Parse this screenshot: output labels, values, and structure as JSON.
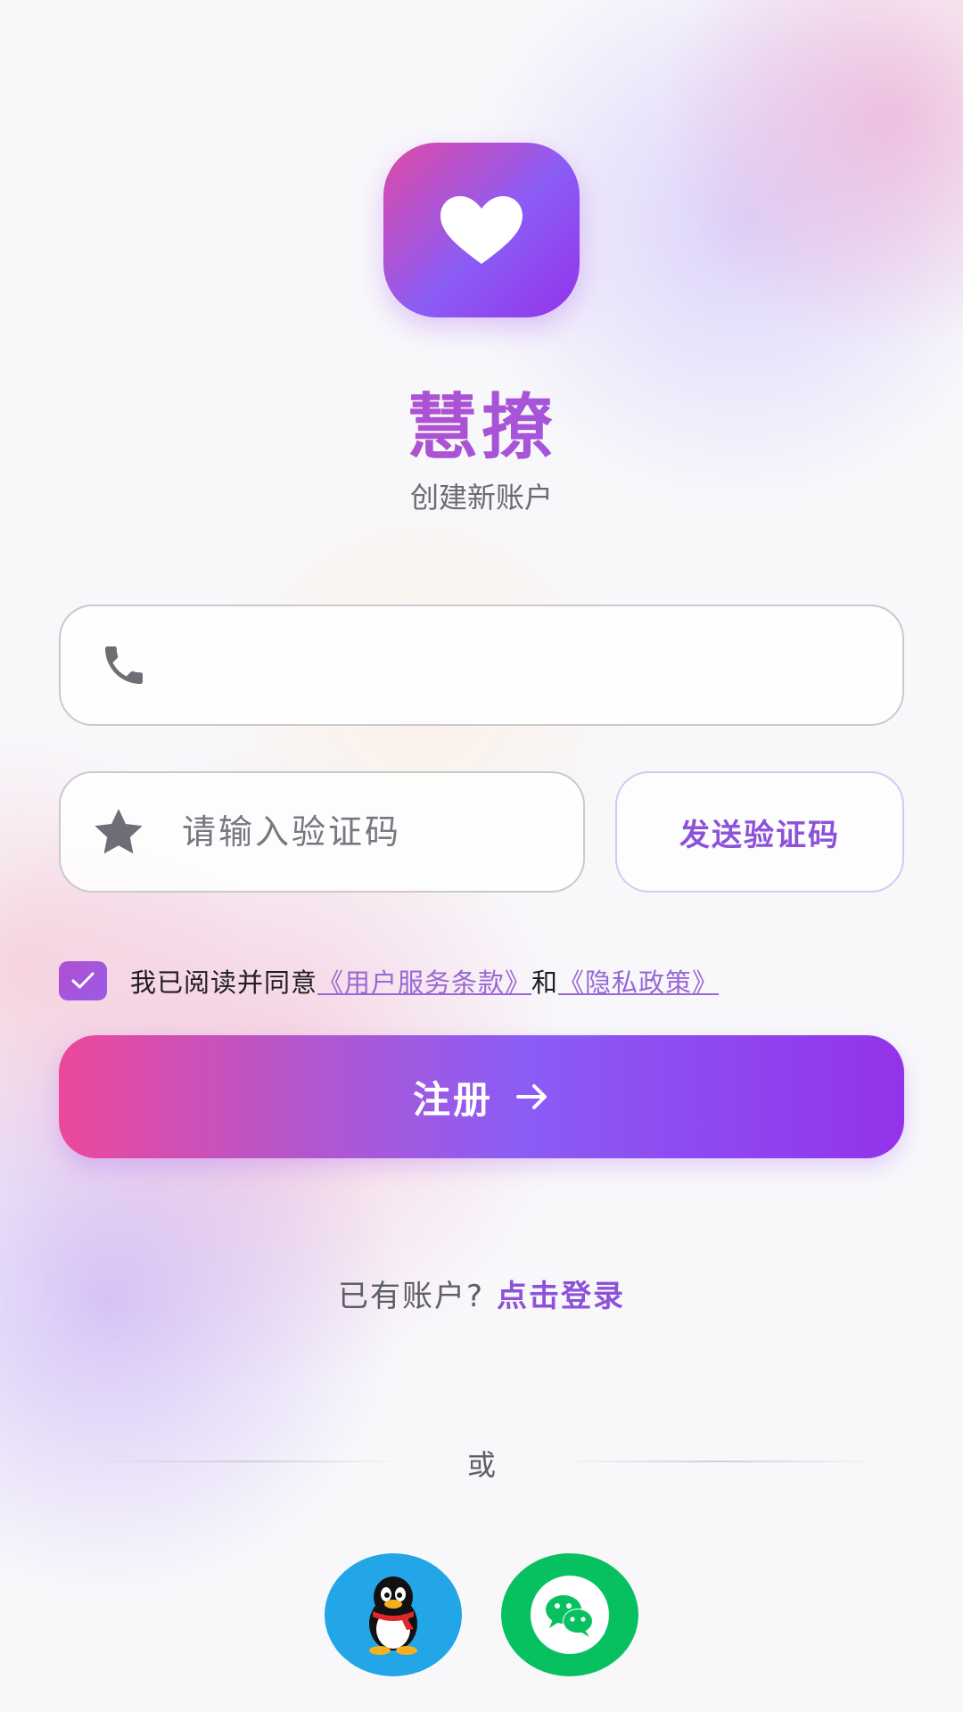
{
  "app": {
    "name": "慧撩",
    "subtitle": "创建新账户"
  },
  "form": {
    "phone": {
      "value": "",
      "placeholder": ""
    },
    "code": {
      "value": "",
      "placeholder": "请输入验证码"
    },
    "send_code_label": "发送验证码"
  },
  "agreement": {
    "checked": true,
    "prefix": "我已阅读并同意",
    "terms_link": "《用户服务条款》",
    "and": "和",
    "privacy_link": "《隐私政策》"
  },
  "register_button": {
    "label": "注册"
  },
  "login_prompt": {
    "question": "已有账户?",
    "link": "点击登录"
  },
  "divider": {
    "text": "或"
  },
  "social": [
    {
      "name": "qq",
      "icon": "qq-penguin-icon",
      "color": "#22a6e8"
    },
    {
      "name": "wechat",
      "icon": "wechat-icon",
      "color": "#07c160"
    }
  ],
  "colors": {
    "accent": "#8d52d8",
    "gradient_start": "#ec4899",
    "gradient_end": "#9333ea"
  }
}
